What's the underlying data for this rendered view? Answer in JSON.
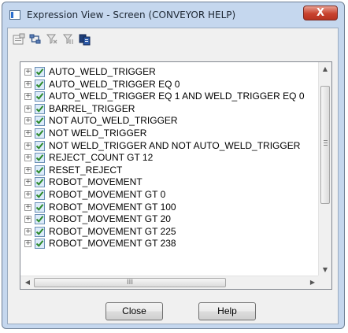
{
  "window": {
    "title": "Expression View - Screen (CONVEYOR HELP)",
    "close_glyph": "X"
  },
  "toolbar": {
    "buttons": [
      {
        "icon": "properties-icon"
      },
      {
        "icon": "expand-tree-icon"
      },
      {
        "icon": "filter-icon"
      },
      {
        "icon": "filter-clear-icon"
      },
      {
        "icon": "copy-icon"
      }
    ]
  },
  "tree": {
    "expander_glyph": "+",
    "items": [
      {
        "label": "AUTO_WELD_TRIGGER",
        "checked": true
      },
      {
        "label": "AUTO_WELD_TRIGGER EQ 0",
        "checked": true
      },
      {
        "label": "AUTO_WELD_TRIGGER EQ 1 AND WELD_TRIGGER EQ 0",
        "checked": true
      },
      {
        "label": "BARREL_TRIGGER",
        "checked": true
      },
      {
        "label": "NOT AUTO_WELD_TRIGGER",
        "checked": true
      },
      {
        "label": "NOT WELD_TRIGGER",
        "checked": true
      },
      {
        "label": "NOT WELD_TRIGGER AND NOT AUTO_WELD_TRIGGER",
        "checked": true
      },
      {
        "label": "REJECT_COUNT GT 12",
        "checked": true
      },
      {
        "label": "RESET_REJECT",
        "checked": true
      },
      {
        "label": "ROBOT_MOVEMENT",
        "checked": true
      },
      {
        "label": "ROBOT_MOVEMENT GT 0",
        "checked": true
      },
      {
        "label": "ROBOT_MOVEMENT GT 100",
        "checked": true
      },
      {
        "label": "ROBOT_MOVEMENT GT 20",
        "checked": true
      },
      {
        "label": "ROBOT_MOVEMENT GT 225",
        "checked": true
      },
      {
        "label": "ROBOT_MOVEMENT GT 238",
        "checked": true
      }
    ]
  },
  "scrollbars": {
    "horizontal_grip": "III"
  },
  "buttons": {
    "close_label": "Close",
    "help_label": "Help"
  },
  "colors": {
    "frame": "#c5d7ee",
    "close_button": "#c8432f",
    "checkbox_check": "#2a8a2a"
  }
}
